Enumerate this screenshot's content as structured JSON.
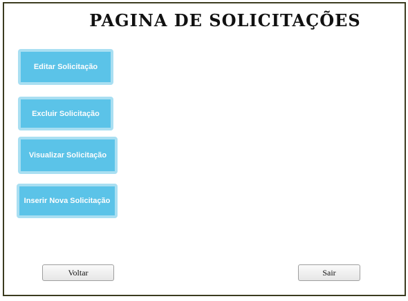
{
  "page": {
    "title": "PAGINA DE SOLICITAÇÕES"
  },
  "actions": {
    "editar": "Editar Solicitação",
    "excluir": "Excluir Solicitação",
    "visualizar": "Visualizar Solicitação",
    "inserir": "Inserir Nova Solicitação"
  },
  "nav": {
    "voltar": "Voltar",
    "sair": "Sair"
  },
  "colors": {
    "action_button": "#5bc3e8",
    "action_button_border": "#a9dff2",
    "frame_border": "#3b3b1f"
  }
}
